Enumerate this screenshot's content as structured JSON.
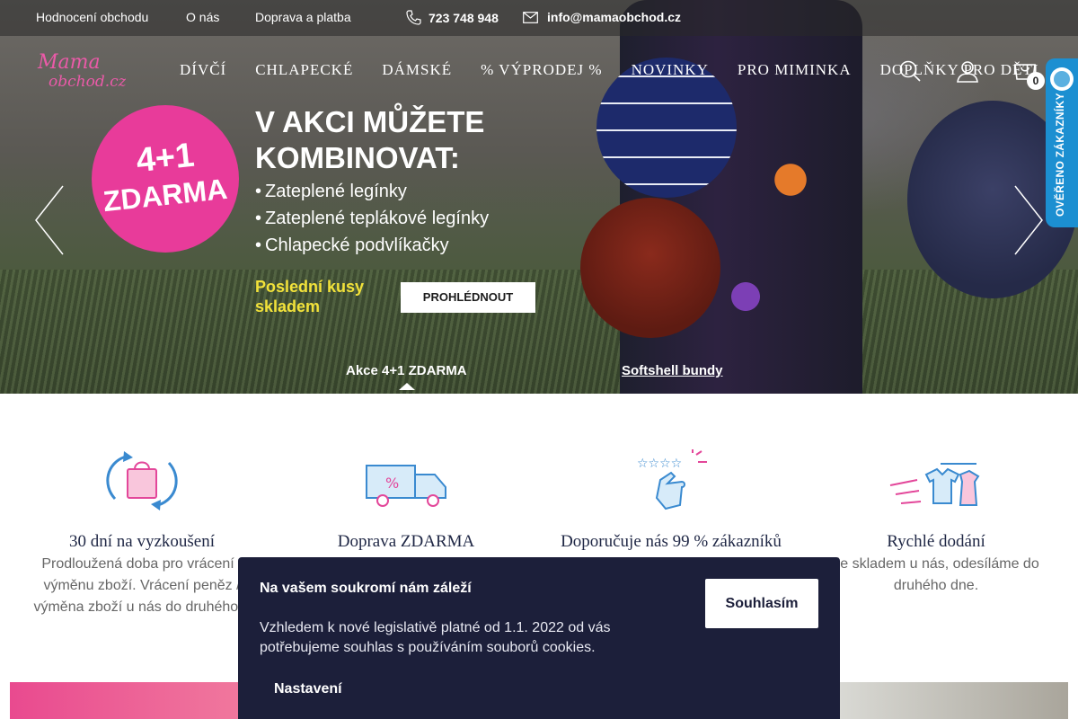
{
  "topbar": {
    "links": [
      "Hodnocení obchodu",
      "O nás",
      "Doprava a platba"
    ],
    "phone": "723 748 948",
    "email": "info@mamaobchod.cz"
  },
  "logo": {
    "text_1": "Mama",
    "text_2": "obchod.cz"
  },
  "nav": [
    "DÍVČÍ",
    "CHLAPECKÉ",
    "DÁMSKÉ",
    "% VÝPRODEJ %",
    "NOVINKY",
    "PRO MIMINKA",
    "DOPLŇKY PRO DĚTI"
  ],
  "cart": {
    "count": "0"
  },
  "verify_badge": {
    "label": "OVĚŘENO ZÁKAZNÍKY"
  },
  "hero": {
    "badge_line1": "4+1",
    "badge_line2": "ZDARMA",
    "title": "V AKCI MŮŽETE KOMBINOVAT:",
    "list": [
      "Zateplené legínky",
      "Zateplené teplákové legínky",
      "Chlapecké podvlíkačky"
    ],
    "subtitle": "Poslední kusy skladem",
    "cta": "PROHLÉDNOUT",
    "tabs": [
      "Akce 4+1 ZDARMA",
      "Softshell bundy"
    ]
  },
  "features": [
    {
      "icon": "return-bag-icon",
      "title": "30 dní na vyzkoušení",
      "text": "Prodloužená doba pro vrácení / výměnu zboží. Vrácení peněz / výměna zboží u nás do druhého d"
    },
    {
      "icon": "delivery-truck-icon",
      "title": "Doprava ZDARMA",
      "text": ""
    },
    {
      "icon": "rating-hand-icon",
      "title": "Doporučuje nás 99 % zákazníků",
      "text": ""
    },
    {
      "icon": "fast-delivery-clothes-icon",
      "title": "Rychlé dodání",
      "text": "še skladem u nás, odesíláme do druhého dne."
    }
  ],
  "cookie": {
    "title": "Na vašem soukromí nám záleží",
    "text": "Vzhledem k nové legislativě platné od 1.1. 2022 od vás potřebujeme souhlas s používáním souborů cookies.",
    "agree": "Souhlasím",
    "settings": "Nastavení"
  },
  "colors": {
    "accent_pink": "#e83b9a",
    "navy": "#1c1f3a",
    "icon_blue": "#2b7fc4",
    "verify_blue": "#1c8fd1"
  }
}
